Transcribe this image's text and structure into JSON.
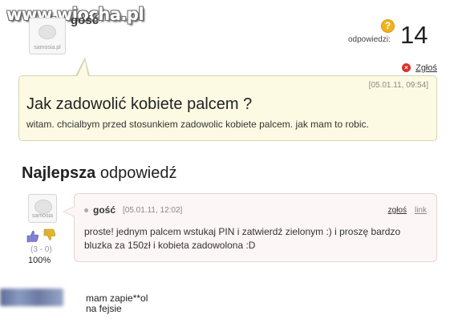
{
  "watermark": "www.wiocha.pl",
  "question": {
    "avatar_tag": "samosia.pl",
    "author": "gość",
    "answers_label": "odpowiedzi:",
    "answers_count": "14",
    "answers_icon": "question-mark",
    "report_label": "Zgłoś",
    "date": "[05.01.11, 09:54]",
    "title": "Jak zadowolić kobiete palcem ?",
    "body": "witam. chcialbym przed stosunkiem zadowolic kobiete palcem. jak mam to robic."
  },
  "best_answer": {
    "heading_bold": "Najlepsza",
    "heading_rest": "odpowiedź",
    "avatar_tag": "samosia",
    "author": "gość",
    "date": "[05.01.11, 12:02]",
    "report_label": "zgłoś",
    "link_label": "link",
    "text": "proste! jednym palcem wstukaj PIN i zatwierdź zielonym :) i proszę bardzo bluzka za 150zł i kobieta zadowolona :D",
    "votes": "(3 - 0)",
    "vote_percent": "100%",
    "colors": {
      "thumb_up": "#7f7fd6",
      "thumb_down": "#e3b52b"
    }
  },
  "caption": {
    "line1": "mam zapie**ol",
    "line2": "na fejsie"
  }
}
